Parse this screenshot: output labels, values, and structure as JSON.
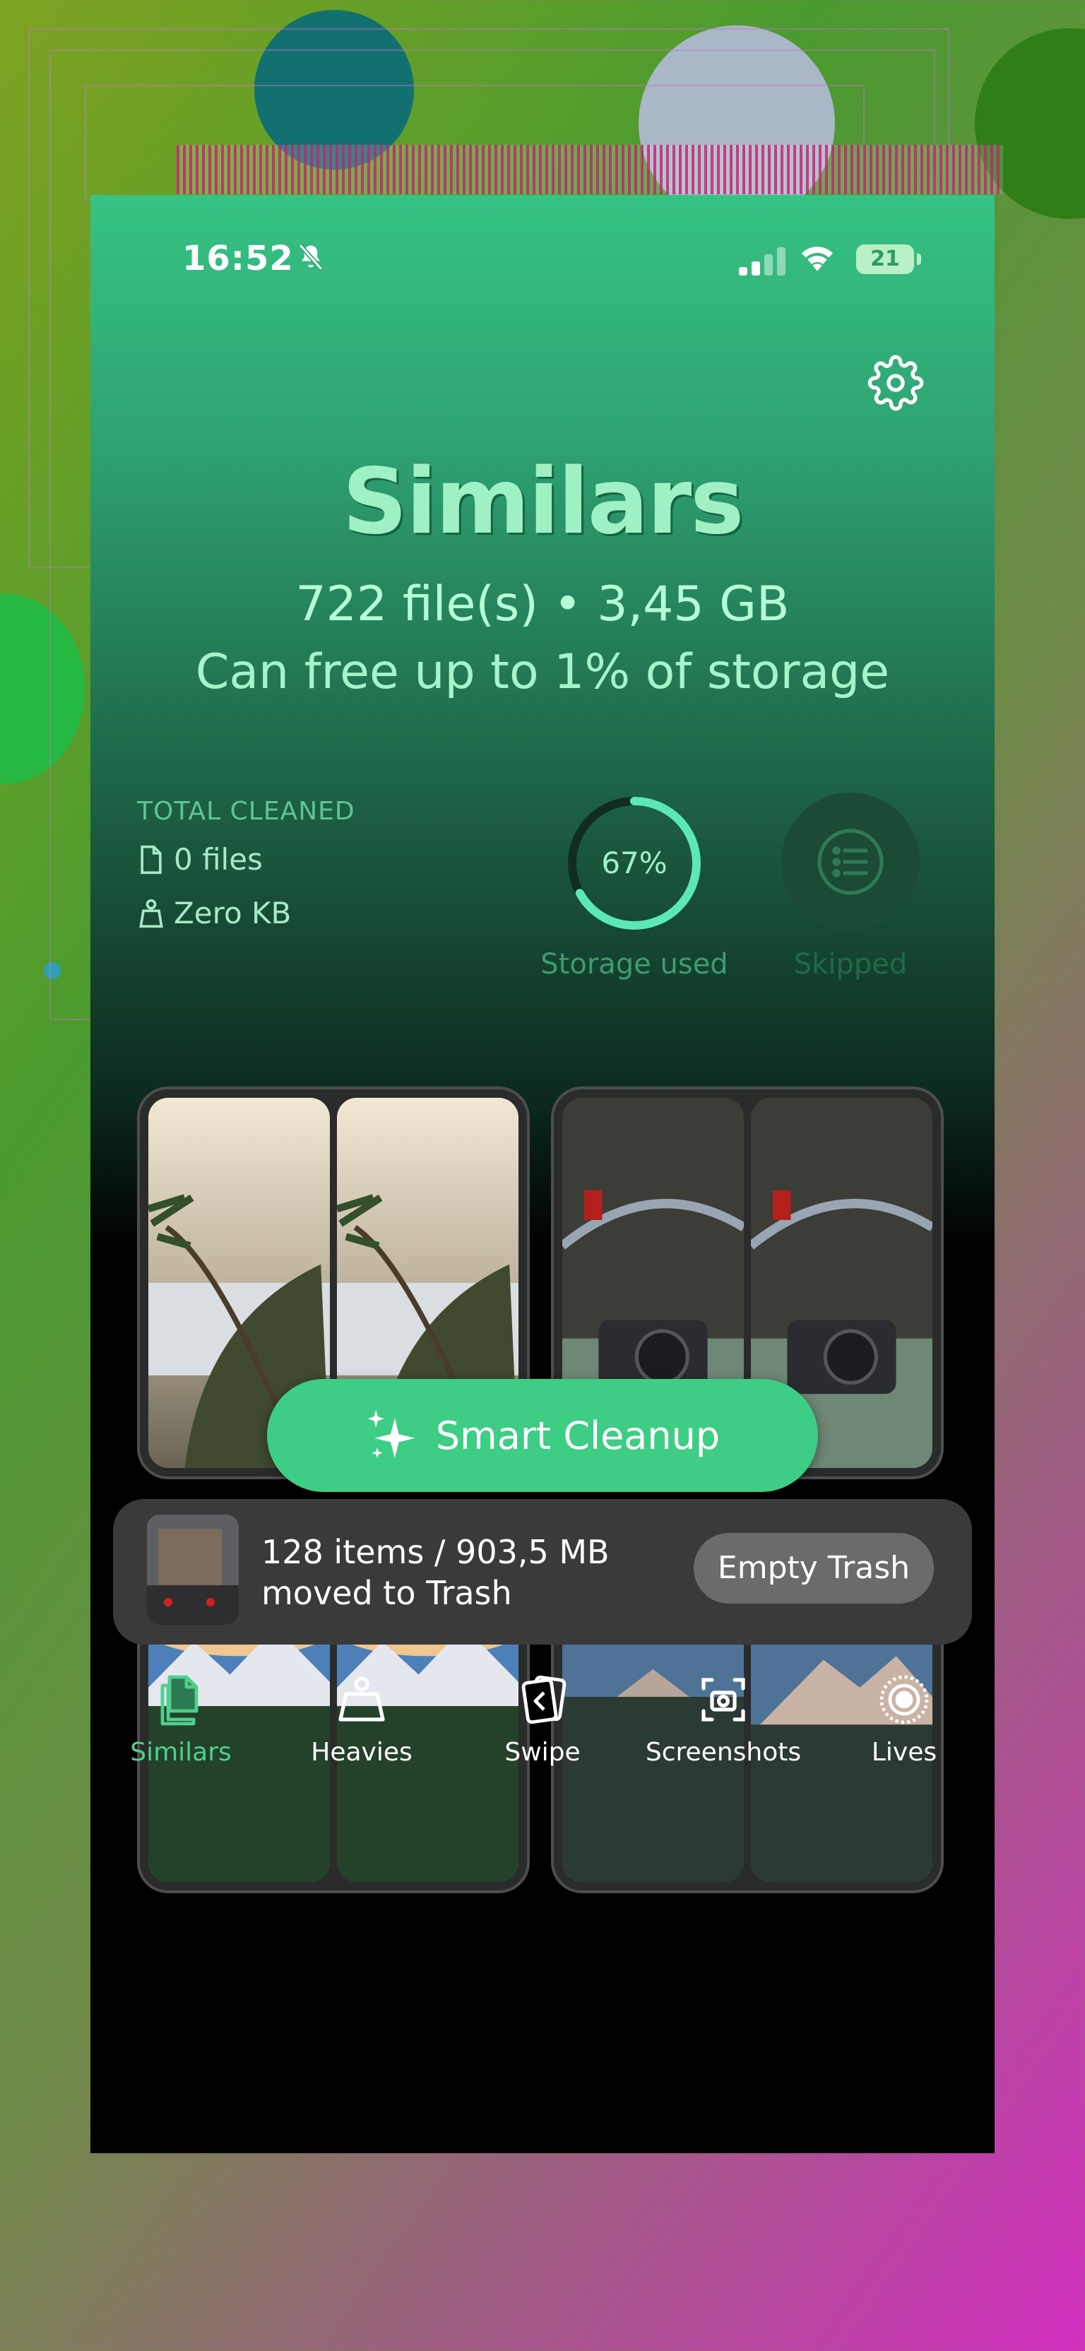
{
  "status": {
    "time": "16:52",
    "battery": "21"
  },
  "header": {
    "title": "Similars",
    "summary": "722 file(s) • 3,45 GB",
    "storage_note": "Can free up to 1% of storage"
  },
  "total_cleaned": {
    "heading": "TOTAL CLEANED",
    "files": "0 files",
    "size": "Zero KB"
  },
  "storage": {
    "percent_text": "67%",
    "percent_value": 67,
    "label": "Storage used"
  },
  "skipped": {
    "label": "Skipped"
  },
  "smart_cleanup": {
    "label": "Smart Cleanup"
  },
  "trash": {
    "line1": "128 items / 903,5 MB",
    "line2": "moved to Trash",
    "button": "Empty Trash"
  },
  "tabs": [
    {
      "label": "Similars",
      "icon": "similars-icon",
      "active": true
    },
    {
      "label": "Heavies",
      "icon": "weight-icon",
      "active": false
    },
    {
      "label": "Swipe",
      "icon": "swipe-icon",
      "active": false
    },
    {
      "label": "Screenshots",
      "icon": "screenshot-icon",
      "active": false
    },
    {
      "label": "Lives",
      "icon": "live-photo-icon",
      "active": false
    }
  ],
  "colors": {
    "accent": "#3dcd84",
    "title": "#9ff0c4",
    "ring": "#5ce8b4",
    "active_tab": "#4fd08e"
  }
}
